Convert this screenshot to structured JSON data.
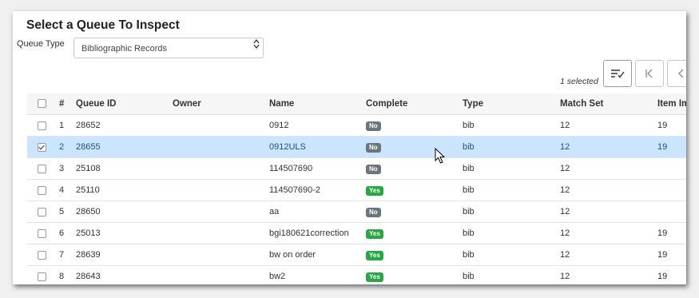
{
  "title": "Select a Queue To Inspect",
  "queue_type": {
    "label": "Queue Type",
    "selected": "Bibliographic Records"
  },
  "selection": {
    "count_text": "1 selected"
  },
  "icons": {
    "sort": "sort-check-icon",
    "first": "first-page-icon",
    "prev": "prev-page-icon"
  },
  "colors": {
    "selected_row": "#cce5ff",
    "badge_yes": "#28a745",
    "badge_no": "#6c757d"
  },
  "table": {
    "columns": [
      "",
      "#",
      "Queue ID",
      "Owner",
      "Name",
      "Complete",
      "Type",
      "Match Set",
      "Item Im"
    ],
    "rows": [
      {
        "checked": false,
        "num": "1",
        "queue_id": "28652",
        "owner": "",
        "name": "0912",
        "complete": "No",
        "type": "bib",
        "match_set": "12",
        "item": "19"
      },
      {
        "checked": true,
        "num": "2",
        "queue_id": "28655",
        "owner": "",
        "name": "0912ULS",
        "complete": "No",
        "type": "bib",
        "match_set": "12",
        "item": "19"
      },
      {
        "checked": false,
        "num": "3",
        "queue_id": "25108",
        "owner": "",
        "name": "114507690",
        "complete": "No",
        "type": "bib",
        "match_set": "12",
        "item": ""
      },
      {
        "checked": false,
        "num": "4",
        "queue_id": "25110",
        "owner": "",
        "name": "114507690-2",
        "complete": "Yes",
        "type": "bib",
        "match_set": "12",
        "item": ""
      },
      {
        "checked": false,
        "num": "5",
        "queue_id": "28650",
        "owner": "",
        "name": "aa",
        "complete": "No",
        "type": "bib",
        "match_set": "12",
        "item": ""
      },
      {
        "checked": false,
        "num": "6",
        "queue_id": "25013",
        "owner": "",
        "name": "bgi180621correction",
        "complete": "Yes",
        "type": "bib",
        "match_set": "12",
        "item": "19"
      },
      {
        "checked": false,
        "num": "7",
        "queue_id": "28639",
        "owner": "",
        "name": "bw on order",
        "complete": "Yes",
        "type": "bib",
        "match_set": "12",
        "item": "19"
      },
      {
        "checked": false,
        "num": "8",
        "queue_id": "28643",
        "owner": "",
        "name": "bw2",
        "complete": "Yes",
        "type": "bib",
        "match_set": "12",
        "item": "19"
      }
    ]
  }
}
